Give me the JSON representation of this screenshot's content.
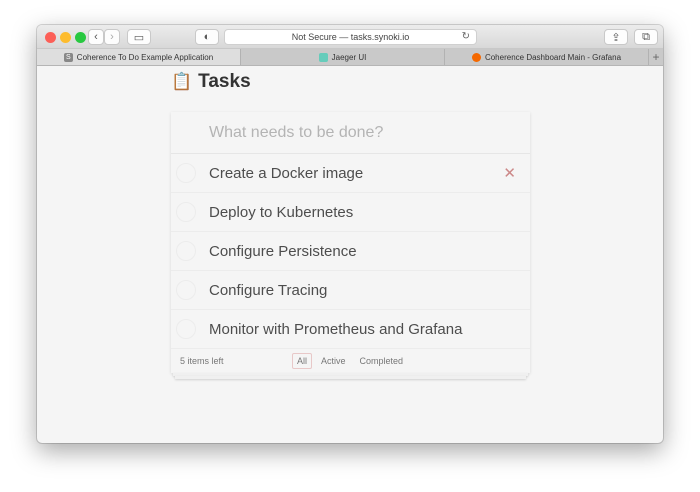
{
  "browser": {
    "url": "Not Secure — tasks.synoki.io",
    "tabs": [
      {
        "label": "Coherence To Do Example Application",
        "icon": "S"
      },
      {
        "label": "Jaeger UI"
      },
      {
        "label": "Coherence Dashboard Main - Grafana"
      }
    ]
  },
  "app": {
    "title": "Tasks",
    "placeholder": "What needs to be done?",
    "todos": [
      {
        "label": "Create a Docker image"
      },
      {
        "label": "Deploy to Kubernetes"
      },
      {
        "label": "Configure Persistence"
      },
      {
        "label": "Configure Tracing"
      },
      {
        "label": "Monitor with Prometheus and Grafana"
      }
    ],
    "footer": {
      "count": "5 items left",
      "filters": [
        "All",
        "Active",
        "Completed"
      ]
    }
  },
  "colors": {
    "background": "#f5f5f5",
    "delete": "#cc8888"
  }
}
